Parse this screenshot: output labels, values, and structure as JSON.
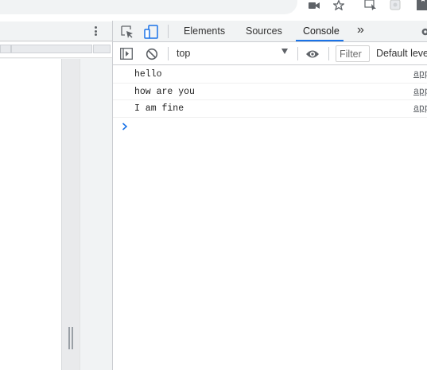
{
  "browser": {
    "icons": [
      "camera-icon",
      "star-icon",
      "extension-puzzle-icon"
    ]
  },
  "devtools": {
    "tabs": [
      {
        "label": "Elements"
      },
      {
        "label": "Sources"
      },
      {
        "label": "Console",
        "active": true
      }
    ],
    "more_tabs_label": "»"
  },
  "console": {
    "context": "top",
    "filter_placeholder": "Filter",
    "levels": "Default levels",
    "messages": [
      {
        "text": "hello",
        "source": "app"
      },
      {
        "text": "how are you",
        "source": "app"
      },
      {
        "text": "I am fine",
        "source": "app"
      }
    ]
  },
  "colors": {
    "accent": "#1a73e8",
    "panel_bg": "#f1f3f4",
    "text": "#303942"
  }
}
